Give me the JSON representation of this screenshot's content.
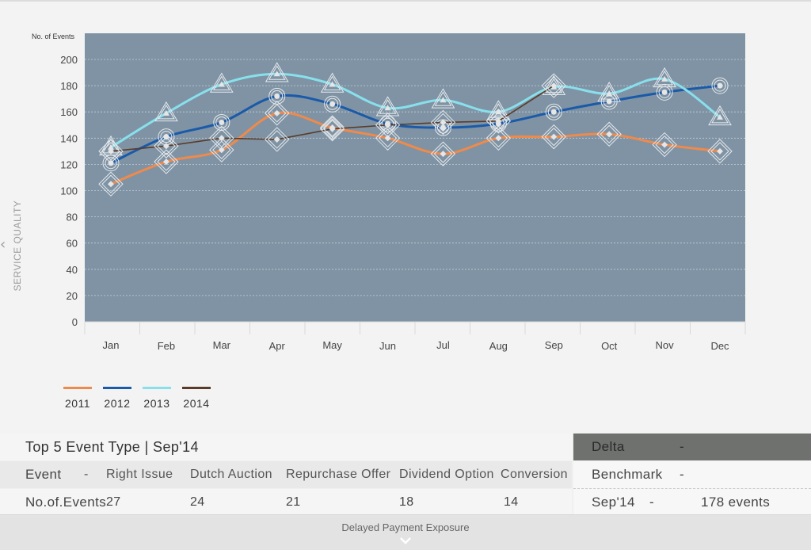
{
  "chart_data": {
    "type": "line",
    "ylabel": "SERVICE QUALITY",
    "yunit_label": "No. of Events",
    "ylim": [
      0,
      200
    ],
    "yticks": [
      0,
      20,
      40,
      60,
      80,
      100,
      120,
      140,
      160,
      180,
      200
    ],
    "categories": [
      "Jan",
      "Feb",
      "Mar",
      "Apr",
      "May",
      "Jun",
      "Jul",
      "Aug",
      "Sep",
      "Oct",
      "Nov",
      "Dec"
    ],
    "grid": true,
    "legend": "bottom-left",
    "series": [
      {
        "name": "2011",
        "color": "#f08a4b",
        "marker": "diamond",
        "values": [
          105,
          122,
          131,
          159,
          148,
          140,
          128,
          140,
          141,
          143,
          135,
          130
        ]
      },
      {
        "name": "2012",
        "color": "#1a5aa8",
        "marker": "circle",
        "values": [
          121,
          141,
          152,
          172,
          166,
          151,
          148,
          151,
          160,
          168,
          175,
          180
        ]
      },
      {
        "name": "2013",
        "color": "#88e0ec",
        "marker": "triangle",
        "values": [
          133,
          159,
          181,
          189,
          181,
          163,
          169,
          160,
          179,
          174,
          185,
          156
        ]
      },
      {
        "name": "2014",
        "color": "#5a3b28",
        "marker": "diamond",
        "values": [
          130,
          134,
          140,
          139,
          147,
          150,
          152,
          153,
          180,
          null,
          null,
          null
        ]
      }
    ]
  },
  "table": {
    "title": "Top 5 Event Type | Sep'14",
    "header_label": "Event",
    "dash": "-",
    "columns": [
      "Right Issue",
      "Dutch Auction",
      "Repurchase Offer",
      "Dividend Option",
      "Conversion"
    ],
    "row_label": "No.of.Events",
    "values": [
      "27",
      "24",
      "21",
      "18",
      "14"
    ]
  },
  "summary": {
    "delta_label": "Delta",
    "delta_value": "-",
    "benchmark_label": "Benchmark",
    "benchmark_value": "-",
    "sep_label": "Sep'14",
    "sep_dash": "-",
    "sep_value": "178 events"
  },
  "footer": {
    "label": "Delayed Payment Exposure",
    "icon": "chevron-down-icon"
  },
  "colors": {
    "plot_bg": "#7f93a4",
    "page_bg": "#f3f3f3",
    "delta_bg": "#6e716e"
  }
}
